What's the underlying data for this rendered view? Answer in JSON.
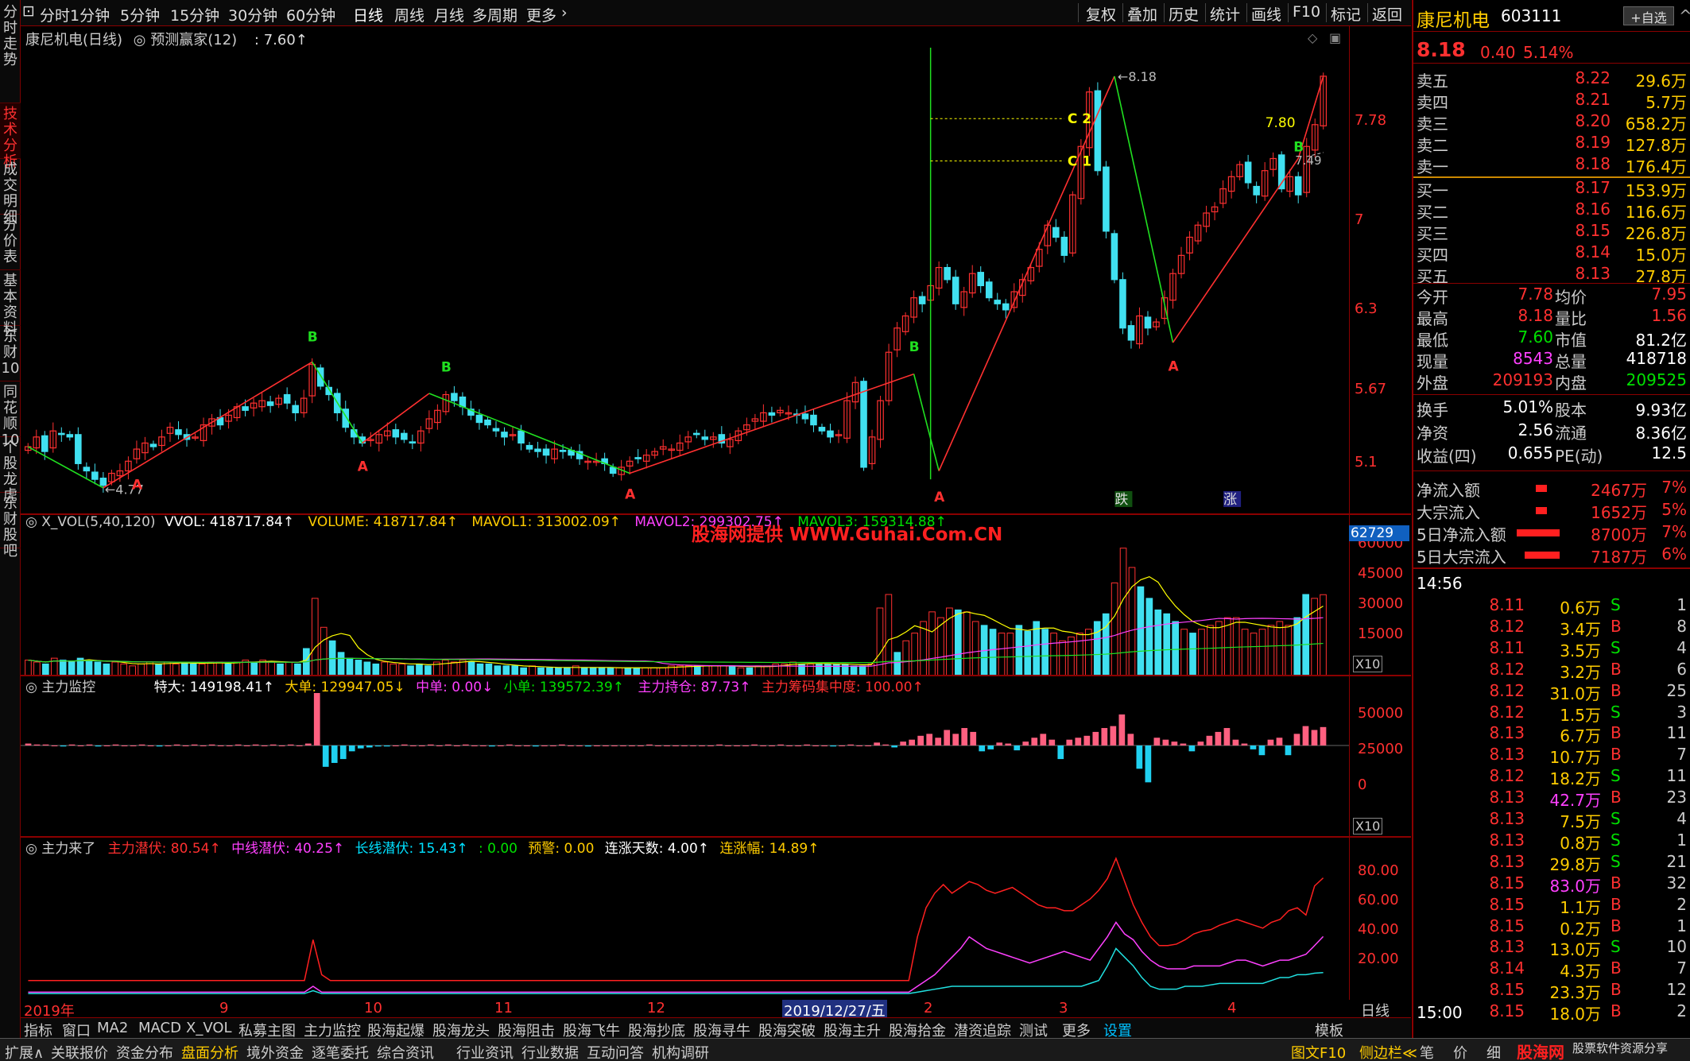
{
  "left_tabs": [
    "分时走势",
    "技术分析",
    "成交明细",
    "分价表",
    "基本资料",
    "东财10",
    "同花顺10",
    "个股龙虎",
    "东财股吧"
  ],
  "active_tab": "技术分析",
  "periods": [
    "分时",
    "1分钟",
    "5分钟",
    "15分钟",
    "30分钟",
    "60分钟",
    "日线",
    "周线",
    "月线",
    "多周期",
    "更多"
  ],
  "active_period": "日线",
  "top_right": [
    "复权",
    "叠加",
    "历史",
    "统计",
    "画线",
    "F10",
    "标记",
    "返回"
  ],
  "main": {
    "title": "康尼机电(日线)",
    "indicator": "预测赢家(12)",
    "value": ": 7.60↑",
    "signals": {
      "die": "跌",
      "zhang": "涨"
    }
  },
  "vol": {
    "title": "X_VOL(5,40,120)",
    "vvol": "VVOL: 418717.84↑",
    "volume": "VOLUME: 418717.84↑",
    "mavol1": "MAVOL1: 313002.09↑",
    "mavol2": "MAVOL2: 299302.75↑",
    "mavol3": "MAVOL3: 159314.88↑",
    "box": "62729",
    "unit": "X10",
    "ticks": [
      "60000",
      "45000",
      "30000",
      "15000"
    ]
  },
  "zl": {
    "title": "主力监控",
    "tedad": "特大: 149198.41↑",
    "dadan": "大单: 129947.05↓",
    "zhong": "中单: 0.00↓",
    "xiao": "小单: 139572.39↑",
    "chicang": "主力持仓: 87.73↑",
    "jizhong": "主力筹码集中度: 100.00↑",
    "unit": "X10",
    "ticks": [
      "50000",
      "25000",
      "0"
    ]
  },
  "zll": {
    "title": "主力来了",
    "a": "主力潜伏: 80.54↑",
    "b": "中线潜伏: 40.25↑",
    "c": "长线潜伏: 15.43↑",
    "d": ": 0.00",
    "e": "预警: 0.00",
    "f": "连涨天数: 4.00↑",
    "g": "连涨幅: 14.89↑",
    "ticks": [
      "80.00",
      "60.00",
      "40.00",
      "20.00"
    ]
  },
  "watermark": "股海网提供 WWW.Guhai.Com.CN",
  "date_axis": {
    "labels": [
      "2019年",
      "9",
      "10",
      "11",
      "12",
      "2019/12/27/五",
      "2",
      "3",
      "4"
    ],
    "right": "日线"
  },
  "bottom_tabs": [
    "指标",
    "窗口",
    "MA2",
    "MACD",
    "X_VOL",
    "私募主图",
    "主力监控",
    "股海起爆",
    "股海龙头",
    "股海阻击",
    "股海飞牛",
    "股海抄底",
    "股海寻牛",
    "股海突破",
    "股海主升",
    "股海拾金",
    "潜资追踪",
    "测试",
    "更多",
    "设置",
    "模板"
  ],
  "bottom2_tabs": [
    "扩展∧",
    "关联报价",
    "资金分布",
    "盘面分析",
    "境外资金",
    "逐笔委托",
    "综合资讯",
    "行业资讯",
    "行业数据",
    "互动问答",
    "机构调研"
  ],
  "bottom2_right": [
    "图文F10",
    "侧边栏≪",
    "笔",
    "价",
    "细"
  ],
  "footer_brand": "股海网",
  "footer_brand2": "股票软件资源分享",
  "footer_url": "http://www.Guhai.Com.CN",
  "stock": {
    "name": "康尼机电",
    "code": "603111",
    "btn": "+自选",
    "price": "8.18",
    "chg": "0.40",
    "pct": "5.14%"
  },
  "sells": [
    [
      "卖五",
      "8.22",
      "29.6万"
    ],
    [
      "卖四",
      "8.21",
      "5.7万"
    ],
    [
      "卖三",
      "8.20",
      "658.2万"
    ],
    [
      "卖二",
      "8.19",
      "127.8万"
    ],
    [
      "卖一",
      "8.18",
      "176.4万"
    ]
  ],
  "buys": [
    [
      "买一",
      "8.17",
      "153.9万"
    ],
    [
      "买二",
      "8.16",
      "116.6万"
    ],
    [
      "买三",
      "8.15",
      "226.8万"
    ],
    [
      "买四",
      "8.14",
      "15.0万"
    ],
    [
      "买五",
      "8.13",
      "27.8万"
    ]
  ],
  "stats": [
    [
      "今开",
      "7.78",
      "均价",
      "7.95"
    ],
    [
      "最高",
      "8.18",
      "量比",
      "1.56"
    ],
    [
      "最低",
      "7.60",
      "市值",
      "81.2亿"
    ],
    [
      "现量",
      "8543",
      "总量",
      "418718"
    ],
    [
      "外盘",
      "209193",
      "内盘",
      "209525"
    ]
  ],
  "stats2": [
    [
      "换手",
      "5.01%",
      "股本",
      "9.93亿"
    ],
    [
      "净资",
      "2.56",
      "流通",
      "8.36亿"
    ],
    [
      "收益(四)",
      "0.655",
      "PE(动)",
      "12.5"
    ]
  ],
  "flows": [
    [
      "净流入额",
      "2467万",
      "7%"
    ],
    [
      "大宗流入",
      "1652万",
      "5%"
    ],
    [
      "5日净流入额",
      "8700万",
      "7%"
    ],
    [
      "5日大宗流入",
      "7187万",
      "6%"
    ]
  ],
  "tick_time": "14:56",
  "ticks": [
    [
      "8.11",
      "0.6万",
      "S",
      "1"
    ],
    [
      "8.12",
      "3.4万",
      "B",
      "8"
    ],
    [
      "8.11",
      "3.5万",
      "S",
      "4"
    ],
    [
      "8.12",
      "3.2万",
      "B",
      "6"
    ],
    [
      "8.12",
      "31.0万",
      "B",
      "25"
    ],
    [
      "8.12",
      "1.5万",
      "S",
      "3"
    ],
    [
      "8.13",
      "6.7万",
      "B",
      "11"
    ],
    [
      "8.13",
      "10.7万",
      "B",
      "7"
    ],
    [
      "8.12",
      "18.2万",
      "S",
      "11"
    ],
    [
      "8.13",
      "42.7万",
      "B",
      "23"
    ],
    [
      "8.13",
      "7.5万",
      "S",
      "4"
    ],
    [
      "8.13",
      "0.8万",
      "S",
      "1"
    ],
    [
      "8.13",
      "29.8万",
      "S",
      "21"
    ],
    [
      "8.15",
      "83.0万",
      "B",
      "32"
    ],
    [
      "8.15",
      "1.1万",
      "B",
      "2"
    ],
    [
      "8.15",
      "0.2万",
      "B",
      "1"
    ],
    [
      "8.13",
      "13.0万",
      "S",
      "10"
    ],
    [
      "8.14",
      "4.3万",
      "B",
      "7"
    ],
    [
      "8.15",
      "23.3万",
      "B",
      "12"
    ],
    [
      "8.15",
      "18.0万",
      "B",
      "2"
    ]
  ],
  "tick_end": "15:00",
  "chart_data": {
    "type": "candlestick",
    "y_ticks": [
      7.78,
      7.0,
      6.3,
      5.67,
      5.1
    ],
    "annotations": {
      "high": "8.18",
      "low": "4.77",
      "c2": "C 2",
      "c1": "C 1",
      "p780": "7.80",
      "p749": "7.49",
      "A": "A",
      "B": "B"
    },
    "ylim": [
      4.7,
      8.35
    ],
    "closes": [
      5.12,
      5.2,
      5.08,
      5.25,
      5.22,
      5.2,
      4.98,
      4.92,
      4.85,
      4.8,
      4.9,
      4.92,
      5.0,
      5.1,
      5.15,
      5.12,
      5.2,
      5.28,
      5.22,
      5.18,
      5.2,
      5.3,
      5.35,
      5.3,
      5.38,
      5.45,
      5.42,
      5.48,
      5.5,
      5.46,
      5.52,
      5.48,
      5.4,
      5.52,
      5.8,
      5.62,
      5.55,
      5.4,
      5.28,
      5.2,
      5.15,
      5.18,
      5.22,
      5.25,
      5.2,
      5.18,
      5.15,
      5.25,
      5.35,
      5.42,
      5.55,
      5.5,
      5.45,
      5.38,
      5.32,
      5.3,
      5.25,
      5.2,
      5.22,
      5.15,
      5.1,
      5.08,
      5.05,
      5.1,
      5.08,
      5.05,
      5.02,
      5.0,
      5.0,
      4.98,
      4.9,
      4.95,
      5.0,
      5.02,
      5.05,
      5.08,
      5.12,
      5.1,
      5.15,
      5.2,
      5.22,
      5.18,
      5.2,
      5.15,
      5.18,
      5.25,
      5.3,
      5.35,
      5.4,
      5.38,
      5.42,
      5.4,
      5.38,
      5.35,
      5.3,
      5.25,
      5.2,
      5.22,
      5.5,
      5.65,
      4.95,
      5.2,
      5.5,
      5.9,
      6.1,
      6.2,
      6.35,
      6.3,
      6.45,
      6.6,
      6.5,
      6.3,
      6.4,
      6.55,
      6.45,
      6.35,
      6.3,
      6.25,
      6.4,
      6.5,
      6.6,
      6.75,
      6.95,
      6.85,
      6.7,
      7.2,
      7.6,
      8.05,
      7.4,
      6.9,
      6.5,
      6.1,
      6.0,
      6.2,
      6.1,
      6.15,
      6.35,
      6.55,
      6.7,
      6.85,
      6.95,
      7.05,
      7.1,
      7.25,
      7.35,
      7.45,
      7.3,
      7.2,
      7.4,
      7.5,
      7.25,
      7.35,
      7.2,
      7.6,
      7.78,
      8.18
    ],
    "volume": [
      8,
      7,
      6,
      9,
      8,
      7,
      9,
      8,
      7,
      6,
      7,
      6,
      5,
      6,
      7,
      6,
      7,
      6,
      7,
      6,
      6,
      7,
      7,
      6,
      7,
      8,
      7,
      8,
      7,
      6,
      7,
      6,
      14,
      40,
      25,
      18,
      12,
      9,
      8,
      7,
      6,
      7,
      6,
      6,
      5,
      6,
      5,
      7,
      8,
      7,
      8,
      7,
      6,
      6,
      5,
      5,
      5,
      4,
      5,
      4,
      4,
      4,
      4,
      5,
      4,
      4,
      4,
      4,
      4,
      4,
      4,
      4,
      4,
      4,
      5,
      5,
      5,
      5,
      5,
      5,
      5,
      5,
      4,
      4,
      5,
      5,
      6,
      6,
      7,
      6,
      6,
      6,
      6,
      6,
      6,
      5,
      5,
      6,
      35,
      42,
      12,
      18,
      22,
      28,
      33,
      30,
      35,
      34,
      33,
      28,
      26,
      24,
      22,
      22,
      26,
      23,
      28,
      24,
      22,
      18,
      20,
      22,
      24,
      28,
      32,
      48,
      66,
      56,
      46,
      40,
      34,
      32,
      28,
      24,
      22,
      24,
      26,
      28,
      30,
      30,
      24,
      22,
      24,
      26,
      28,
      26,
      30,
      42,
      40,
      41.9
    ],
    "mainflow": [
      2,
      1,
      1,
      0,
      -1,
      1,
      0,
      1,
      -1,
      0,
      1,
      0,
      0,
      1,
      0,
      -1,
      0,
      1,
      0,
      1,
      0,
      1,
      0,
      0,
      1,
      0,
      1,
      0,
      1,
      0,
      1,
      0,
      2,
      58,
      -22,
      -18,
      -14,
      -6,
      -3,
      -2,
      -1,
      -1,
      0,
      1,
      0,
      0,
      1,
      0,
      1,
      0,
      1,
      0,
      0,
      -1,
      0,
      1,
      0,
      0,
      -1,
      0,
      0,
      1,
      0,
      0,
      -1,
      0,
      0,
      0,
      0,
      0,
      0,
      1,
      0,
      0,
      0,
      0,
      0,
      0,
      0,
      1,
      0,
      0,
      0,
      1,
      0,
      0,
      1,
      0,
      0,
      1,
      0,
      0,
      -1,
      0,
      1,
      0,
      0,
      3,
      1,
      -2,
      4,
      6,
      10,
      12,
      8,
      16,
      12,
      18,
      14,
      -6,
      -4,
      3,
      2,
      -5,
      4,
      8,
      12,
      6,
      -14,
      6,
      8,
      10,
      14,
      18,
      20,
      32,
      12,
      -24,
      -38,
      8,
      6,
      4,
      2,
      -6,
      4,
      10,
      14,
      18,
      6,
      2,
      -4,
      -10,
      6,
      8,
      -10,
      12,
      20,
      16,
      19
    ],
    "zl_a": [
      10,
      10,
      10,
      10,
      10,
      10,
      10,
      10,
      10,
      10,
      10,
      10,
      10,
      10,
      10,
      10,
      10,
      10,
      10,
      10,
      10,
      10,
      10,
      10,
      10,
      10,
      10,
      10,
      10,
      10,
      10,
      10,
      10,
      38,
      14,
      10,
      10,
      10,
      10,
      10,
      10,
      10,
      10,
      10,
      10,
      10,
      10,
      10,
      10,
      10,
      10,
      10,
      10,
      10,
      10,
      10,
      10,
      10,
      10,
      10,
      10,
      10,
      10,
      10,
      10,
      10,
      10,
      10,
      10,
      10,
      10,
      10,
      10,
      10,
      10,
      10,
      10,
      10,
      10,
      10,
      10,
      10,
      10,
      10,
      10,
      10,
      10,
      10,
      10,
      10,
      10,
      10,
      10,
      10,
      10,
      10,
      10,
      10,
      10,
      10,
      10,
      10,
      10,
      40,
      60,
      70,
      76,
      70,
      74,
      78,
      76,
      72,
      70,
      72,
      74,
      70,
      66,
      62,
      60,
      60,
      58,
      58,
      62,
      66,
      72,
      80,
      94,
      78,
      62,
      50,
      40,
      34,
      34,
      35,
      38,
      42,
      44,
      45,
      48,
      50,
      52,
      50,
      48,
      46,
      50,
      52,
      58,
      60,
      55,
      75,
      80.54
    ],
    "zl_b": [
      2,
      2,
      2,
      2,
      2,
      2,
      2,
      2,
      2,
      2,
      2,
      2,
      2,
      2,
      2,
      2,
      2,
      2,
      2,
      2,
      2,
      2,
      2,
      2,
      2,
      2,
      2,
      2,
      2,
      2,
      2,
      2,
      2,
      6,
      2,
      2,
      2,
      2,
      2,
      2,
      2,
      2,
      2,
      2,
      2,
      2,
      2,
      2,
      2,
      2,
      2,
      2,
      2,
      2,
      2,
      2,
      2,
      2,
      2,
      2,
      2,
      2,
      2,
      2,
      2,
      2,
      2,
      2,
      2,
      2,
      2,
      2,
      2,
      2,
      2,
      2,
      2,
      2,
      2,
      2,
      2,
      2,
      2,
      2,
      2,
      2,
      2,
      2,
      2,
      2,
      2,
      2,
      2,
      2,
      2,
      2,
      2,
      2,
      2,
      2,
      2,
      2,
      2,
      6,
      10,
      14,
      20,
      26,
      32,
      40,
      36,
      32,
      30,
      28,
      26,
      24,
      22,
      24,
      26,
      28,
      30,
      28,
      26,
      24,
      32,
      40,
      50,
      42,
      38,
      30,
      24,
      20,
      18,
      18,
      18,
      20,
      20,
      20,
      20,
      22,
      24,
      24,
      22,
      20,
      22,
      24,
      24,
      26,
      28,
      34,
      40.25
    ],
    "zl_c": [
      1,
      1,
      1,
      1,
      1,
      1,
      1,
      1,
      1,
      1,
      1,
      1,
      1,
      1,
      1,
      1,
      1,
      1,
      1,
      1,
      1,
      1,
      1,
      1,
      1,
      1,
      1,
      1,
      1,
      1,
      1,
      1,
      1,
      3,
      1,
      1,
      1,
      1,
      1,
      1,
      1,
      1,
      1,
      1,
      1,
      1,
      1,
      1,
      1,
      1,
      1,
      1,
      1,
      1,
      1,
      1,
      1,
      1,
      1,
      1,
      1,
      1,
      1,
      1,
      1,
      1,
      1,
      1,
      1,
      1,
      1,
      1,
      1,
      1,
      1,
      1,
      1,
      1,
      1,
      1,
      1,
      1,
      1,
      1,
      1,
      1,
      1,
      1,
      1,
      1,
      1,
      1,
      1,
      1,
      1,
      1,
      1,
      1,
      1,
      1,
      1,
      1,
      1,
      2,
      3,
      4,
      5,
      6,
      6,
      6,
      6,
      6,
      6,
      6,
      6,
      6,
      6,
      6,
      6,
      6,
      6,
      6,
      6,
      8,
      10,
      20,
      32,
      26,
      20,
      12,
      6,
      4,
      4,
      4,
      6,
      6,
      6,
      7,
      8,
      8,
      8,
      8,
      8,
      8,
      10,
      12,
      12,
      14,
      14,
      15,
      15.43
    ]
  }
}
